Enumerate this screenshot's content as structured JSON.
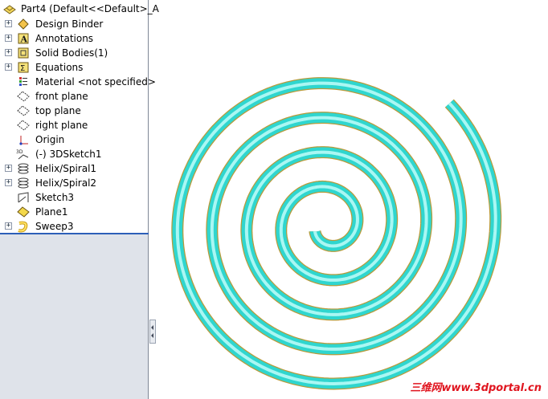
{
  "tree": {
    "root": "Part4  (Default<<Default>_A",
    "items": [
      {
        "label": "Design Binder",
        "expandable": true,
        "icon": "design-binder-icon"
      },
      {
        "label": "Annotations",
        "expandable": true,
        "icon": "annotations-icon"
      },
      {
        "label": "Solid Bodies(1)",
        "expandable": true,
        "icon": "solid-bodies-icon"
      },
      {
        "label": "Equations",
        "expandable": true,
        "icon": "equations-icon"
      },
      {
        "label": "Material <not specified>",
        "expandable": false,
        "icon": "material-icon"
      },
      {
        "label": "front plane",
        "expandable": false,
        "icon": "plane-icon"
      },
      {
        "label": "top plane",
        "expandable": false,
        "icon": "plane-icon"
      },
      {
        "label": "right plane",
        "expandable": false,
        "icon": "plane-icon"
      },
      {
        "label": "Origin",
        "expandable": false,
        "icon": "origin-icon"
      },
      {
        "label": "(-) 3DSketch1",
        "expandable": false,
        "icon": "3d-sketch-icon"
      },
      {
        "label": "Helix/Spiral1",
        "expandable": true,
        "icon": "helix-icon"
      },
      {
        "label": "Helix/Spiral2",
        "expandable": true,
        "icon": "helix-icon"
      },
      {
        "label": "Sketch3",
        "expandable": false,
        "icon": "sketch-icon"
      },
      {
        "label": "Plane1",
        "expandable": false,
        "icon": "plane-feature-icon"
      },
      {
        "label": "Sweep3",
        "expandable": true,
        "icon": "sweep-icon"
      }
    ]
  },
  "viewport": {
    "model": "spiral-sweep",
    "colors": {
      "body": "#2fd6cf",
      "edge": "#b89a3a",
      "highlight": "#b8fbf6"
    }
  },
  "watermark": "三维网www.3dportal.cn"
}
